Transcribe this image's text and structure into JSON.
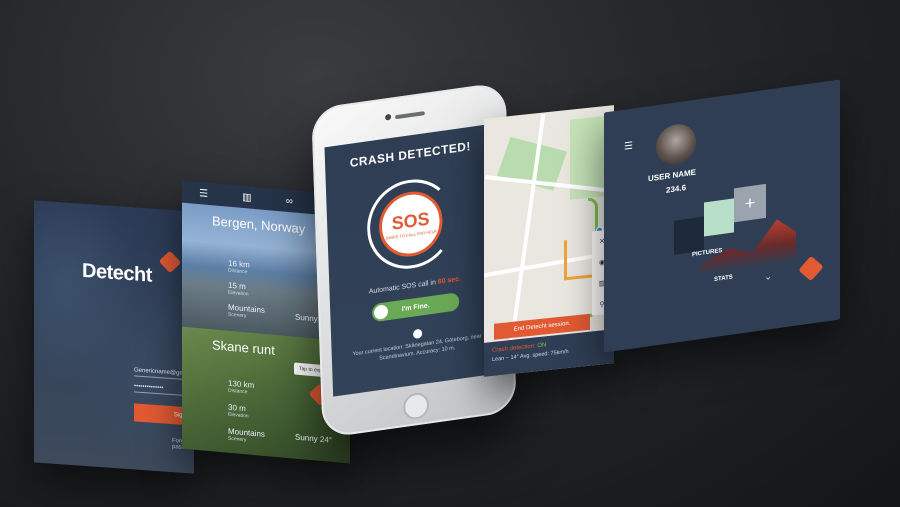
{
  "login": {
    "logo_text": "Detecht",
    "email_value": "Genericname@gmail.com",
    "password_value": "••••••••••••••",
    "signin_label": "Sign in",
    "forgot_label": "Forgot password?"
  },
  "routes": {
    "cards": [
      {
        "title": "Bergen, Norway",
        "distance_value": "16 km",
        "distance_label": "Distance",
        "elevation_value": "15 m",
        "elevation_label": "Elevation",
        "scenery_value": "Mountains",
        "scenery_label": "Scenery",
        "weather": "Sunny 22°"
      },
      {
        "title": "Skane runt",
        "distance_value": "130 km",
        "distance_label": "Distance",
        "elevation_value": "30 m",
        "elevation_label": "Elevation",
        "scenery_value": "Mountains",
        "scenery_label": "Scenery",
        "weather": "Sunny 24°"
      }
    ],
    "tooltip": "Tap to explore"
  },
  "phone": {
    "crash_title": "CRASH DETECTED!",
    "sos": "SOS",
    "sos_sub": "SWIPE TO CALL FOR HELP",
    "auto_sos_prefix": "Automatic SOS call in",
    "auto_sos_time": "60 sec.",
    "fine_label": "I'm Fine.",
    "location_text": "Your current location: Skånegatan 24, Göteborg, near Scandinavium. Accuracy: 10 m."
  },
  "map": {
    "end_session_label": "End Detecht session.",
    "detection_label": "Crash detection:",
    "detection_status": "ON",
    "lean_text": "Lean ~ 14° Avg. speed: 75km/h"
  },
  "profile": {
    "username": "USER NAME",
    "score": "234.6",
    "pictures_label": "PICTURES",
    "stats_label": "STATS"
  },
  "colors": {
    "accent": "#e25a33",
    "panel": "#2f3e54",
    "success": "#6aa956"
  }
}
